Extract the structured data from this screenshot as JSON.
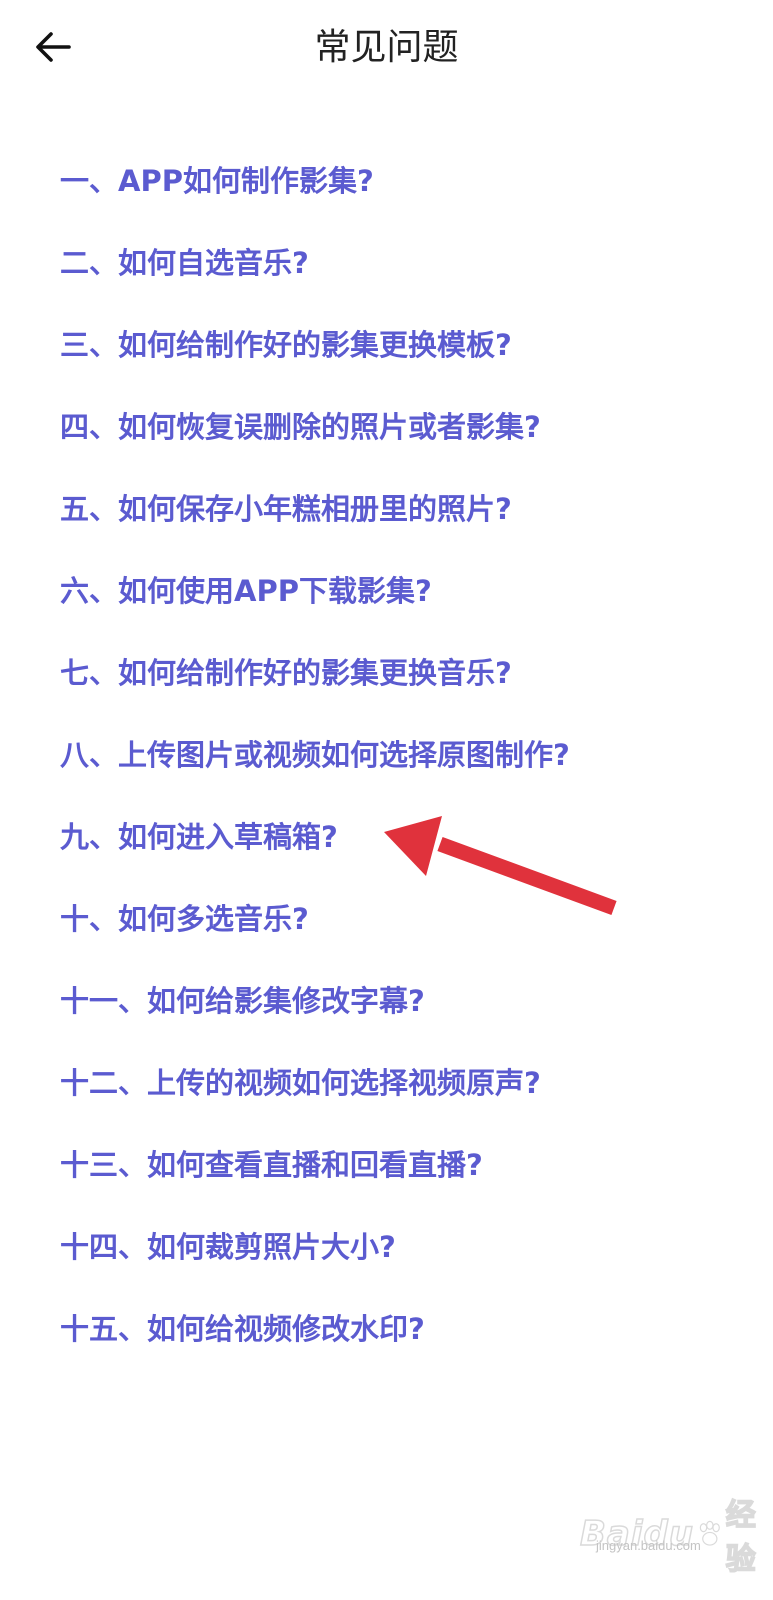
{
  "header": {
    "title": "常见问题",
    "back_icon": "back-arrow-icon"
  },
  "faq": {
    "color": "#5b5bd0",
    "items": [
      "一、APP如何制作影集?",
      "二、如何自选音乐?",
      "三、如何给制作好的影集更换模板?",
      "四、如何恢复误删除的照片或者影集?",
      "五、如何保存小年糕相册里的照片?",
      "六、如何使用APP下载影集?",
      "七、如何给制作好的影集更换音乐?",
      "八、上传图片或视频如何选择原图制作?",
      "九、如何进入草稿箱?",
      "十、如何多选音乐?",
      "十一、如何给影集修改字幕?",
      "十二、上传的视频如何选择视频原声?",
      "十三、如何查看直播和回看直播?",
      "十四、如何裁剪照片大小?",
      "十五、如何给视频修改水印?"
    ]
  },
  "annotation": {
    "arrow_color": "#e0323c",
    "arrow_icon": "red-pointer-arrow-icon"
  },
  "watermark": {
    "logo": "Baidu",
    "cn": "经验",
    "url": "jingyan.baidu.com"
  }
}
